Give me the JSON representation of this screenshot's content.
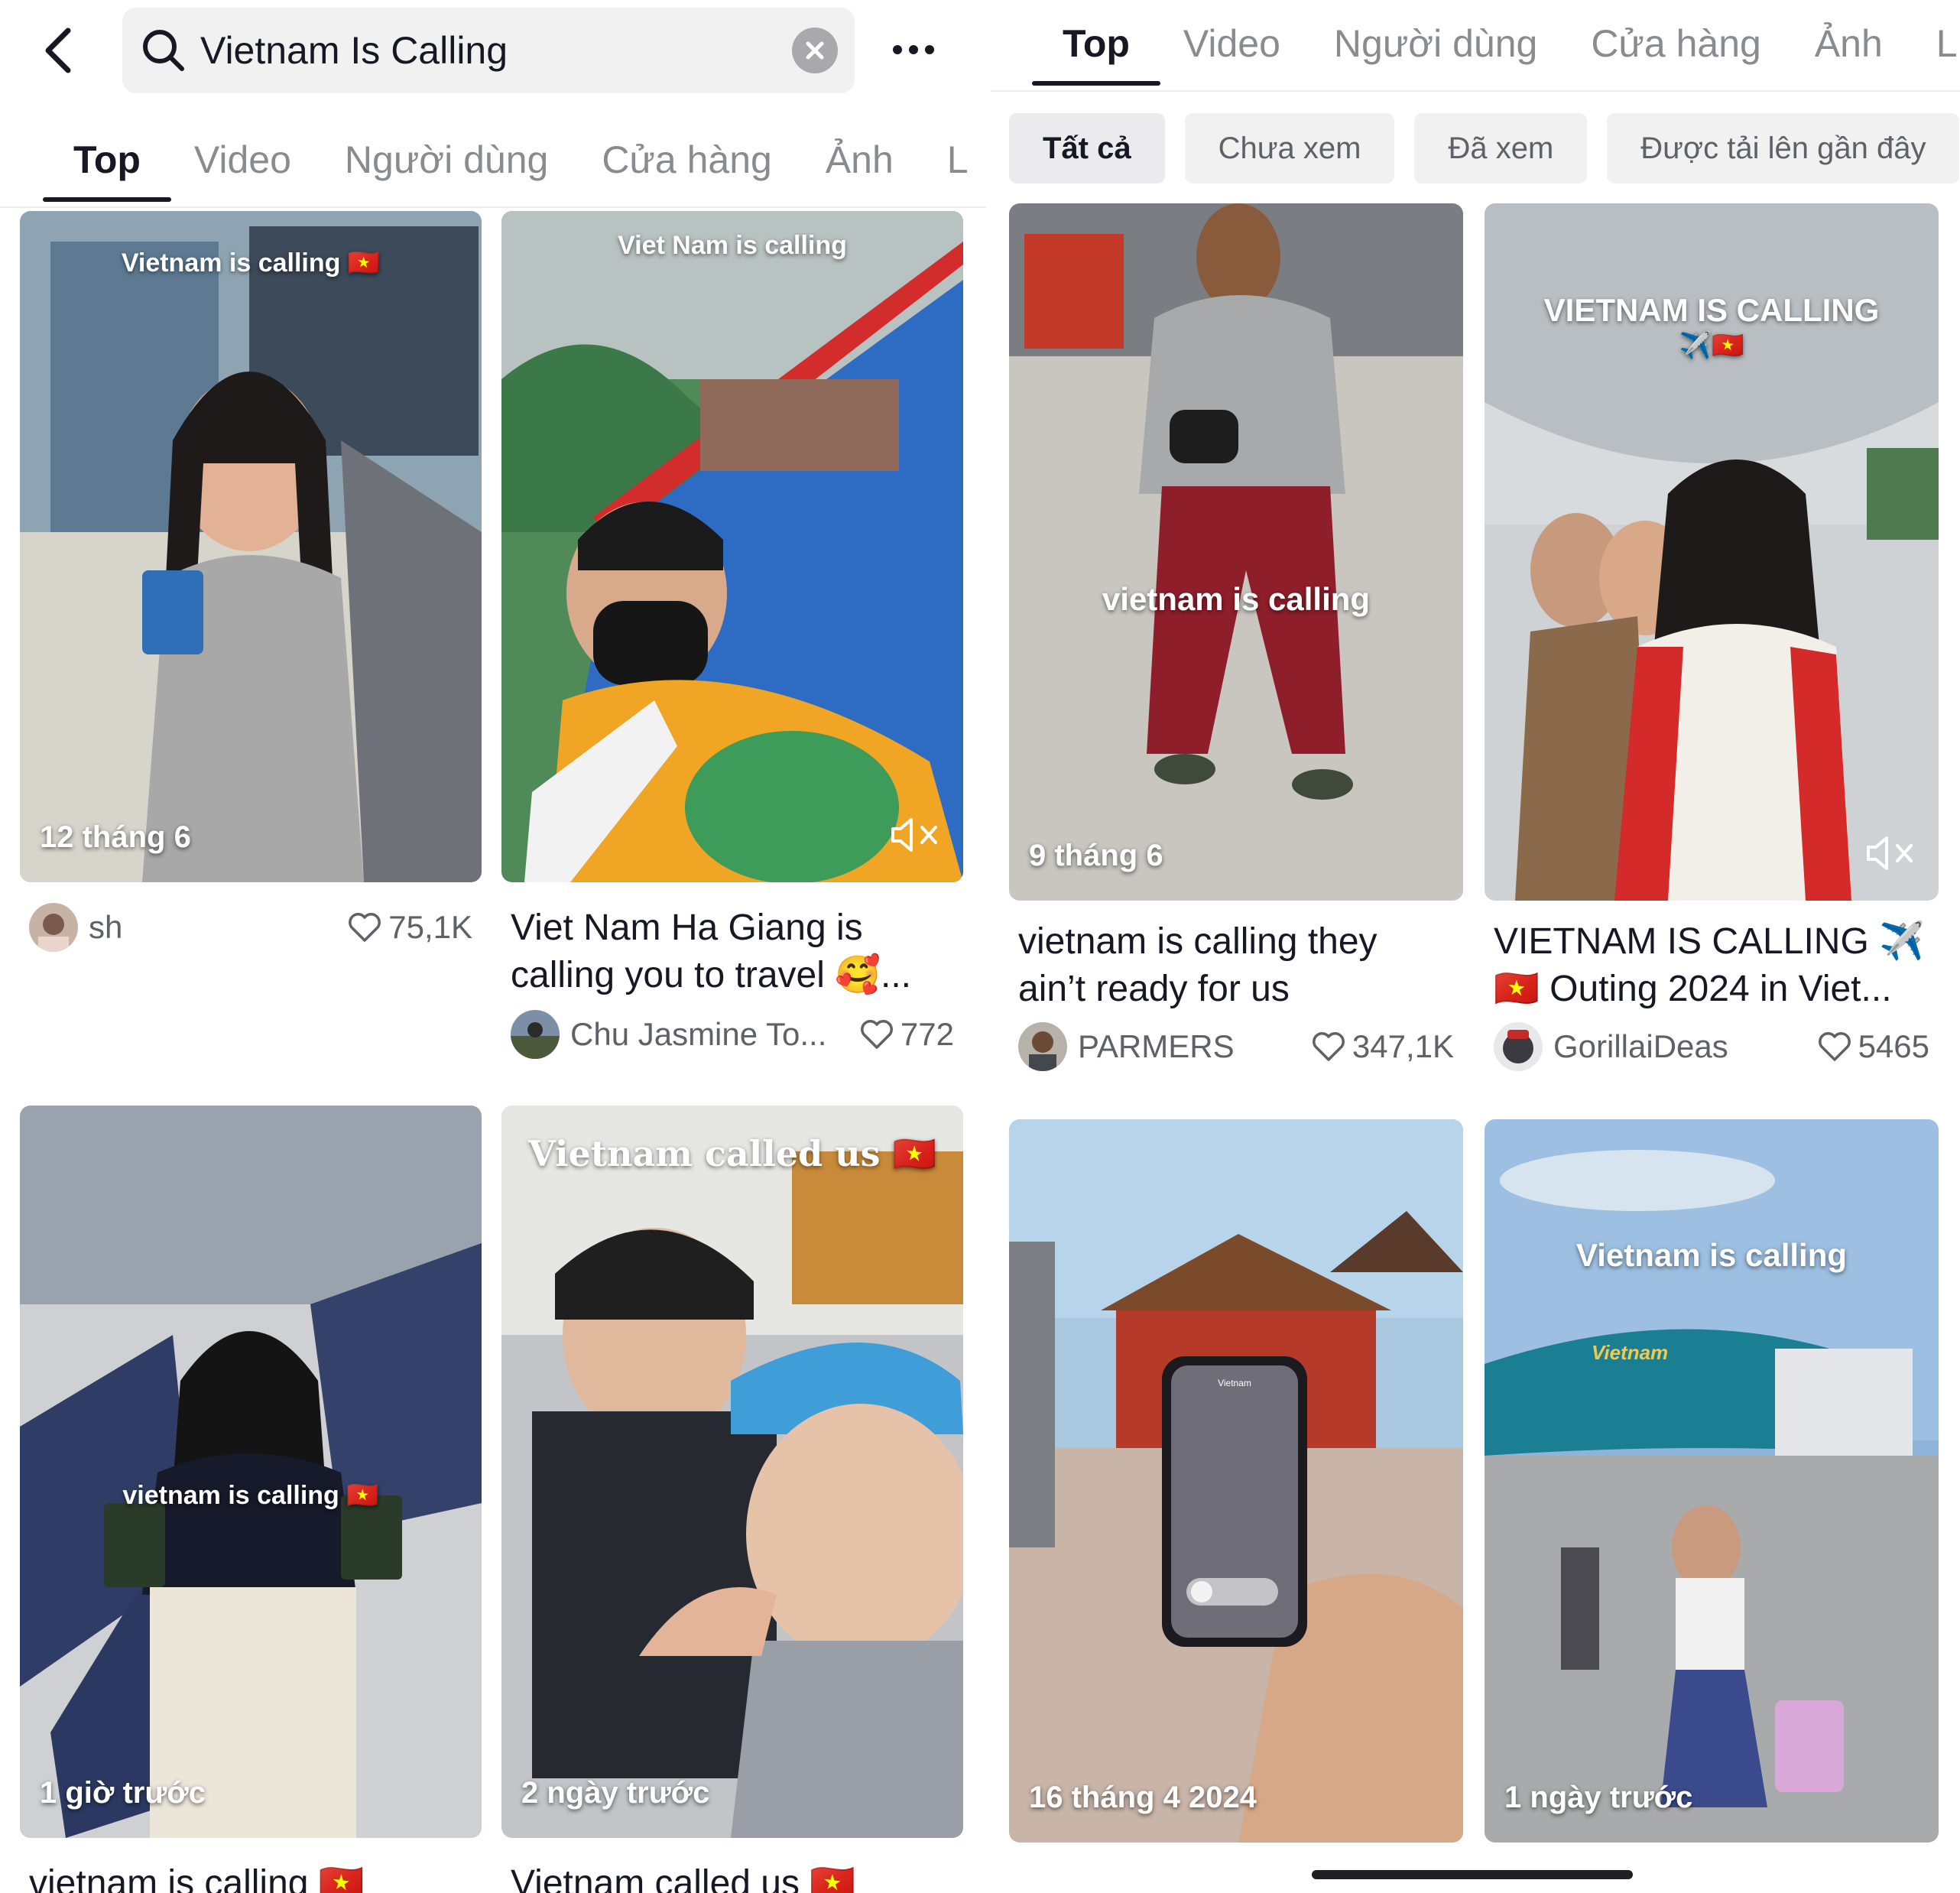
{
  "search": {
    "query": "Vietnam Is Calling"
  },
  "tabs": {
    "top": "Top",
    "video": "Video",
    "users": "Người dùng",
    "shop": "Cửa hàng",
    "photos": "Ảnh",
    "more": "L"
  },
  "filters": {
    "all": "Tất cả",
    "unwatched": "Chưa xem",
    "watched": "Đã xem",
    "recent": "Được tải lên gần đây"
  },
  "left_cards": [
    {
      "overlay": "Vietnam is calling 🇻🇳",
      "date": "12 tháng 6",
      "caption": "",
      "author": "sh",
      "likes": "75,1K"
    },
    {
      "overlay": "Viet Nam is calling",
      "date": "",
      "caption1": "Viet Nam Ha Giang is",
      "caption2": "calling you to travel 🥰...",
      "author": "Chu Jasmine To...",
      "likes": "772"
    },
    {
      "overlay": "vietnam is calling 🇻🇳",
      "date": "1 giờ trước",
      "caption1": "vietnam is calling 🇻🇳"
    },
    {
      "overlay": "Vietnam called us 🇻🇳",
      "date": "2 ngày trước",
      "caption1": "Vietnam called us 🇻🇳"
    }
  ],
  "right_cards": [
    {
      "overlay": "vietnam is calling",
      "date": "9 tháng 6",
      "caption1": "vietnam is calling  they",
      "caption2": "ain’t ready for us",
      "author": "PARMERS",
      "likes": "347,1K"
    },
    {
      "overlay": "VIETNAM IS CALLING",
      "overlay2": "✈️🇻🇳",
      "caption1": "VIETNAM IS CALLING ✈️",
      "caption2": "🇻🇳 Outing 2024 in Viet...",
      "author": "GorillaiDeas",
      "likes": "5465"
    },
    {
      "phone_text": "Vietnam",
      "date": "16 tháng 4 2024"
    },
    {
      "overlay": "Vietnam is calling",
      "plane_text": "Vietnam",
      "date": "1 ngày trước"
    }
  ]
}
